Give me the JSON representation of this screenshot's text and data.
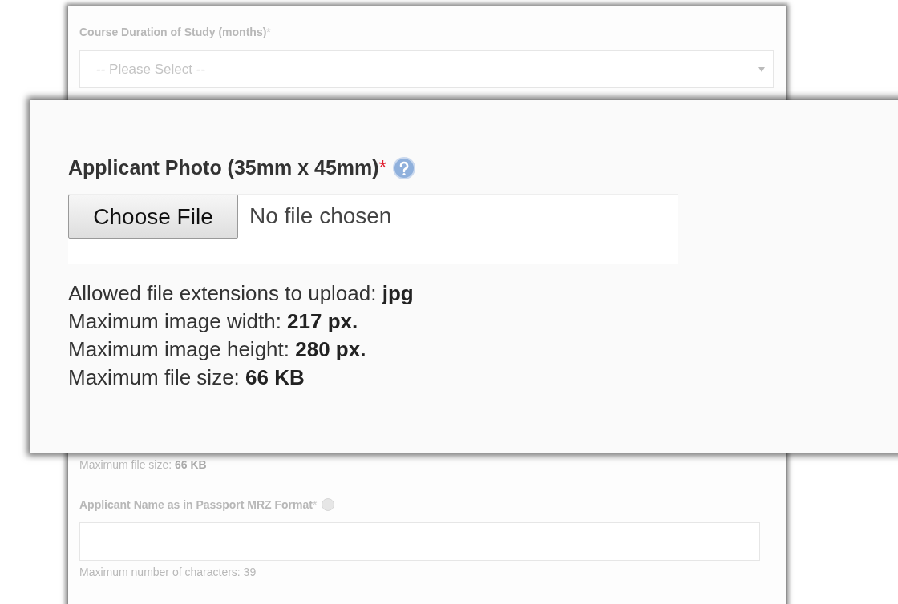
{
  "background_form": {
    "course_duration": {
      "label": "Course Duration of Study (months)",
      "required_mark": "*",
      "placeholder": "-- Please Select --"
    },
    "photo_size_note": "Maximum file size: **66 KB**",
    "applicant_name": {
      "label": "Applicant Name as in Passport MRZ Format",
      "required_mark": "*",
      "hint": "Maximum number of characters: 39"
    }
  },
  "zoomed_photo_field": {
    "label": "Applicant Photo (35mm x 45mm)",
    "required_mark": "*",
    "button": "Choose File",
    "file_status": "No file chosen",
    "rules": [
      "Allowed file extensions to upload: **jpg**",
      "Maximum image width: **217 px.**",
      "Maximum image height: **280 px.**",
      "Maximum file size: **66 KB**"
    ]
  }
}
